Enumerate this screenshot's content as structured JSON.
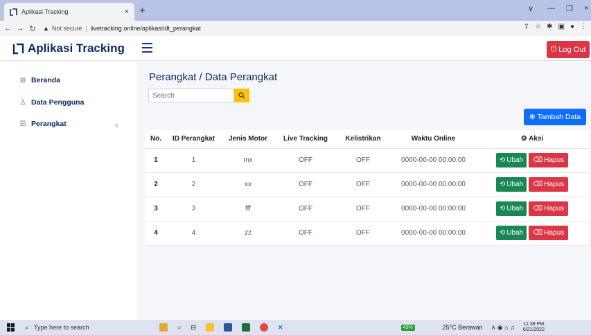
{
  "browser": {
    "tab_title": "Aplikasi Tracking",
    "tab_close": "×",
    "new_tab": "+",
    "not_secure": "Not secure",
    "url": "livetracking.online/aplikasi/dt_perangkat"
  },
  "app": {
    "brand": "Aplikasi Tracking",
    "logout_label": "Log Out",
    "accent": "#0d2b63"
  },
  "sidebar": {
    "items": [
      {
        "label": "Beranda",
        "icon": "grid-icon"
      },
      {
        "label": "Data Pengguna",
        "icon": "user-icon"
      },
      {
        "label": "Perangkat",
        "icon": "list-icon"
      }
    ],
    "chevron": "∨"
  },
  "main": {
    "title": "Perangkat / Data Perangkat",
    "search_placeholder": "Search",
    "add_label": "Tambah Data"
  },
  "table": {
    "headers": [
      "No.",
      "ID Perangkat",
      "Jenis Motor",
      "Live Tracking",
      "Kelistrikan",
      "Waktu Online",
      "Aksi"
    ],
    "rows": [
      {
        "no": "1",
        "id": "1",
        "motor": "mx",
        "live": "OFF",
        "listrik": "OFF",
        "waktu": "0000-00-00 00:00:00"
      },
      {
        "no": "2",
        "id": "2",
        "motor": "xx",
        "live": "OFF",
        "listrik": "OFF",
        "waktu": "0000-00-00 00:00:00"
      },
      {
        "no": "3",
        "id": "3",
        "motor": "fff",
        "live": "OFF",
        "listrik": "OFF",
        "waktu": "0000-00-00 00:00:00"
      },
      {
        "no": "4",
        "id": "4",
        "motor": "zz",
        "live": "OFF",
        "listrik": "OFF",
        "waktu": "0000-00-00 00:00:00"
      }
    ],
    "edit_label": "Ubah",
    "delete_label": "Hapus"
  },
  "taskbar": {
    "search_placeholder": "Type here to search",
    "battery": "43%",
    "weather": "25°C Berawan",
    "time": "11:38 PM",
    "date": "6/21/2022"
  }
}
